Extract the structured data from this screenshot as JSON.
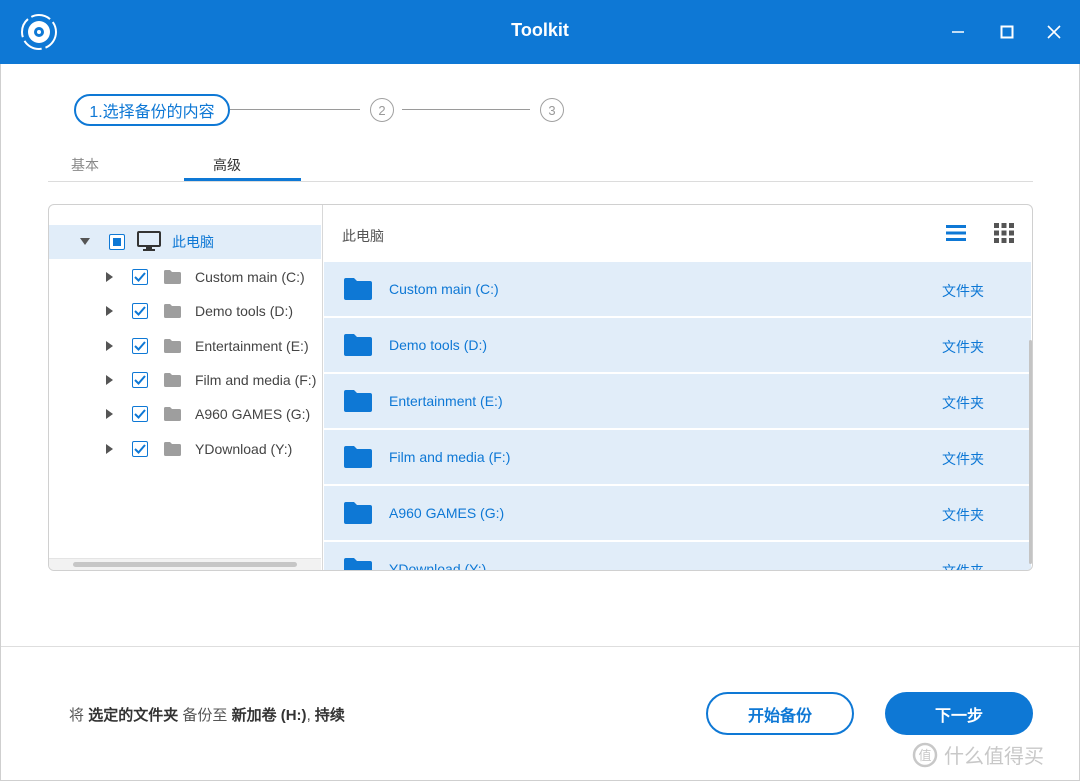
{
  "window": {
    "title": "Toolkit",
    "logo_icon": "disc-logo-icon",
    "accent_color": "#0e78d5"
  },
  "stepper": {
    "step1_label": "1.选择备份的内容",
    "step2_label": "2",
    "step3_label": "3"
  },
  "tabs": [
    {
      "label": "基本",
      "active": false
    },
    {
      "label": "高级",
      "active": true
    }
  ],
  "tree": {
    "root": {
      "label": "此电脑",
      "icon": "monitor-icon",
      "state": "partial"
    },
    "items": [
      {
        "label": "Custom main (C:)",
        "checked": true,
        "icon": "folder-icon"
      },
      {
        "label": "Demo tools (D:)",
        "checked": true,
        "icon": "folder-icon"
      },
      {
        "label": "Entertainment (E:)",
        "checked": true,
        "icon": "folder-icon"
      },
      {
        "label": "Film and media (F:)",
        "checked": true,
        "icon": "folder-icon"
      },
      {
        "label": "A960 GAMES (G:)",
        "checked": true,
        "icon": "folder-icon"
      },
      {
        "label": "YDownload (Y:)",
        "checked": true,
        "icon": "folder-icon"
      }
    ]
  },
  "list": {
    "breadcrumb": "此电脑",
    "view_modes": [
      "list-view-icon",
      "grid-view-icon"
    ],
    "rows": [
      {
        "name": "Custom main (C:)",
        "type": "文件夹"
      },
      {
        "name": "Demo tools (D:)",
        "type": "文件夹"
      },
      {
        "name": "Entertainment (E:)",
        "type": "文件夹"
      },
      {
        "name": "Film and media (F:)",
        "type": "文件夹"
      },
      {
        "name": "A960 GAMES (G:)",
        "type": "文件夹"
      },
      {
        "name": "YDownload (Y:)",
        "type": "文件夹"
      }
    ]
  },
  "footer": {
    "text_prefix": "将",
    "text_selected": "选定的文件夹",
    "text_middle": "备份至",
    "text_target": "新加卷 (H:)",
    "text_comma": ",",
    "text_suffix": "持续",
    "start_backup_label": "开始备份",
    "next_label": "下一步"
  },
  "watermark": {
    "text": "什么值得买"
  }
}
